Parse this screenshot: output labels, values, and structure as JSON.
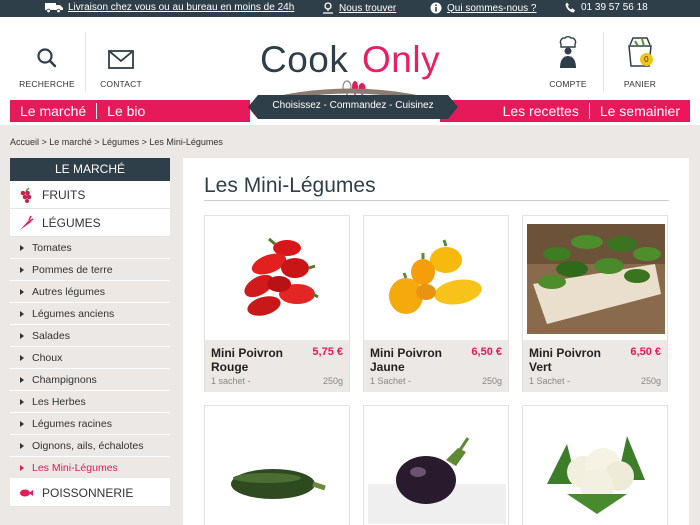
{
  "topbar": {
    "delivery": "Livraison chez vous ou au bureau en moins de 24h",
    "find_us": "Nous trouver",
    "about": "Qui sommes-nous ?",
    "phone": "01 39 57 56 18"
  },
  "header": {
    "search_label": "RECHERCHE",
    "contact_label": "CONTACT",
    "account_label": "COMPTE",
    "cart_label": "PANIER",
    "cart_count": "0",
    "logo_word1": "Cook",
    "logo_word2": "Only",
    "tagline": "Choisissez - Commandez - Cuisinez"
  },
  "nav": {
    "left": [
      "Le marché",
      "Le bio"
    ],
    "right": [
      "Les recettes",
      "Le semainier"
    ]
  },
  "breadcrumb": "Accueil > Le marché > Légumes > Les Mini-Légumes",
  "sidebar": {
    "title": "LE MARCHÉ",
    "cat_fruits": "FRUITS",
    "cat_legumes": "LÉGUMES",
    "cat_poissonnerie": "POISSONNERIE",
    "subs": [
      "Tomates",
      "Pommes de terre",
      "Autres légumes",
      "Légumes anciens",
      "Salades",
      "Choux",
      "Champignons",
      "Les Herbes",
      "Légumes racines",
      "Oignons, ails, échalotes",
      "Les Mini-Légumes"
    ]
  },
  "main": {
    "title": "Les Mini-Légumes",
    "products": [
      {
        "name": "Mini Poivron Rouge",
        "price": "5,75 €",
        "unit": "1 sachet -",
        "weight": "250g"
      },
      {
        "name": "Mini Poivron Jaune",
        "price": "6,50 €",
        "unit": "1 Sachet -",
        "weight": "250g"
      },
      {
        "name": "Mini Poivron Vert",
        "price": "6,50 €",
        "unit": "1 Sachet -",
        "weight": "250g"
      }
    ]
  },
  "colors": {
    "accent": "#e6195a",
    "navy": "#2e3f49",
    "grey": "#ebe8e6"
  }
}
